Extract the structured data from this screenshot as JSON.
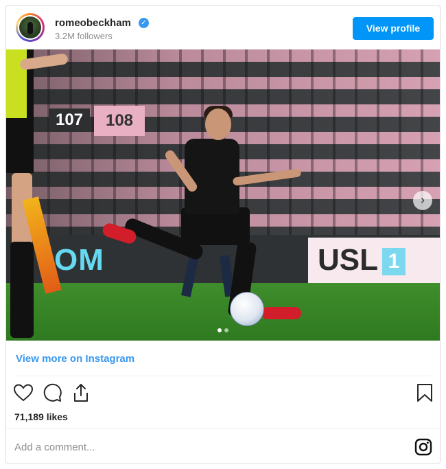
{
  "header": {
    "username": "romeobeckham",
    "verified_icon": "verified-badge-icon",
    "followers": "3.2M followers",
    "view_profile_label": "View profile"
  },
  "post": {
    "photo_signs": {
      "sign_107": "107",
      "sign_108": "108",
      "banner_left": "OM",
      "banner_right": "USL",
      "banner_badge": "1"
    },
    "carousel": {
      "next_icon": "chevron-right-icon",
      "total": 2,
      "current": 1
    },
    "view_more_label": "View more on Instagram",
    "actions": [
      "heart-icon",
      "comment-icon",
      "share-icon",
      "bookmark-icon"
    ],
    "likes": "71,189 likes"
  },
  "comment": {
    "placeholder": "Add a comment...",
    "brand_icon": "instagram-icon"
  },
  "colors": {
    "primary_blue": "#0095f6",
    "link_blue": "#3897f0",
    "text": "#262626",
    "muted": "#8e8e8e",
    "border": "#dbdbdb"
  }
}
